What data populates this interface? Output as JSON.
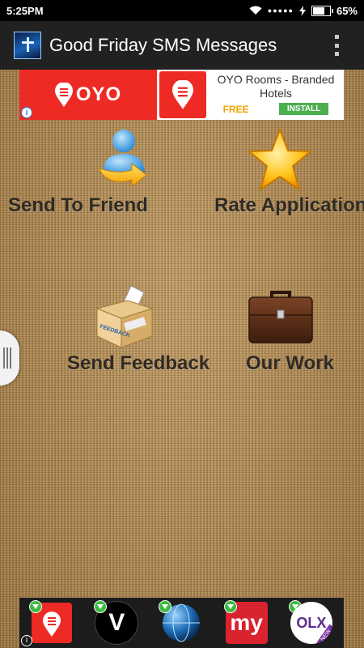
{
  "status_bar": {
    "time": "5:25PM",
    "signal": "●●●●●",
    "battery_percent": "65%",
    "battery_level": 0.65
  },
  "app_bar": {
    "title": "Good Friday SMS Messages",
    "icon": "app-cross-icon",
    "menu_icon": "overflow-menu-icon"
  },
  "ad_top": {
    "brand_text": "OYO",
    "title": "OYO Rooms - Branded Hotels",
    "price": "FREE",
    "install_label": "INSTALL",
    "info_label": "i",
    "brand_color": "#ee2a24"
  },
  "menu_items": [
    {
      "label": "Send To Friend",
      "icon": "send-to-friend-icon"
    },
    {
      "label": "Rate Application",
      "icon": "star-icon"
    },
    {
      "label": "Send Feedback",
      "icon": "feedback-box-icon",
      "icon_text": "FEEDBACK"
    },
    {
      "label": "Our Work",
      "icon": "briefcase-icon"
    }
  ],
  "ad_bottom": {
    "info_label": "i",
    "apps": [
      {
        "icon": "oyo-app-icon"
      },
      {
        "icon": "v-app-icon",
        "text": "V"
      },
      {
        "icon": "globe-app-icon"
      },
      {
        "icon": "my-app-icon",
        "text": "my"
      },
      {
        "icon": "olx-app-icon",
        "text": "OLX",
        "badge": "NEW"
      }
    ]
  },
  "colors": {
    "status_bar": "#000000",
    "app_bar": "#212121",
    "label_text": "#2e2a26",
    "download_badge": "#3dbb42"
  }
}
